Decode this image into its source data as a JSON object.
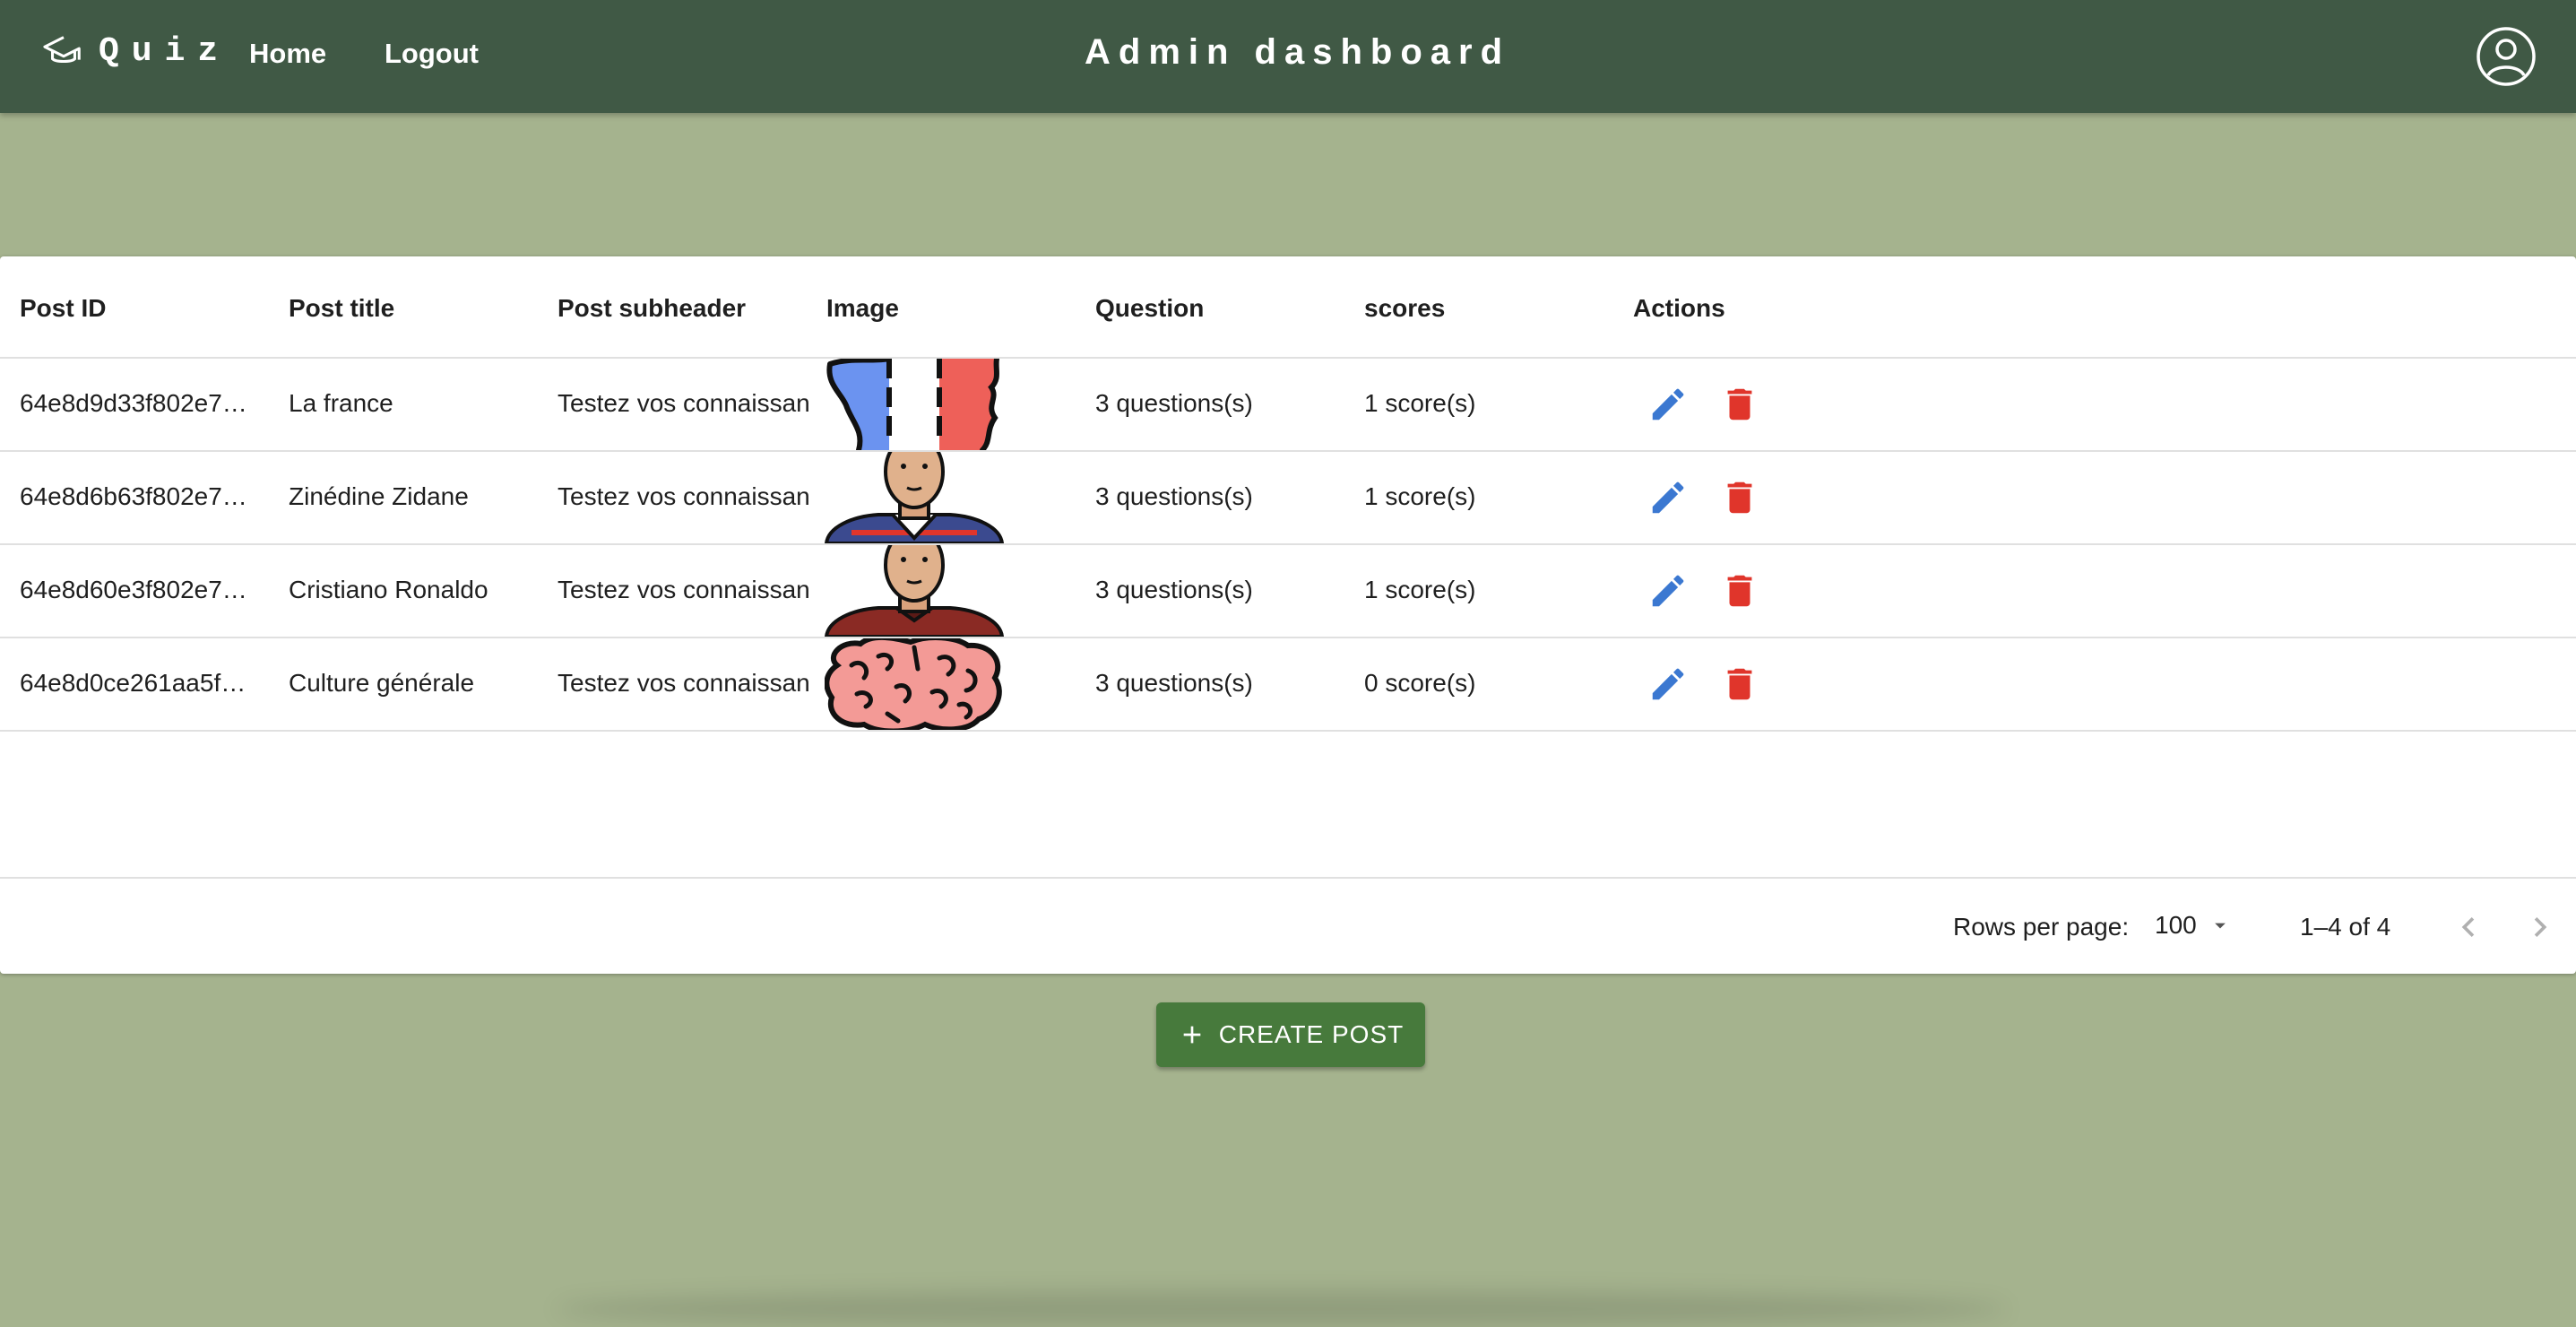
{
  "appbar": {
    "brand": "Quiz",
    "nav": {
      "home": "Home",
      "logout": "Logout"
    },
    "title": "Admin dashboard",
    "account_icon": "account-circle-icon"
  },
  "table": {
    "columns": [
      "Post ID",
      "Post title",
      "Post subheader",
      "Image",
      "Question",
      "scores",
      "Actions"
    ],
    "rows": [
      {
        "id": "64e8d9d33f802e7…",
        "title": "La france",
        "subheader": "Testez vos connaissan",
        "image": "france-map-flag",
        "questions": "3 questions(s)",
        "scores": "1 score(s)"
      },
      {
        "id": "64e8d6b63f802e7…",
        "title": "Zinédine Zidane",
        "subheader": "Testez vos connaissan",
        "image": "player-avatar-blue",
        "questions": "3 questions(s)",
        "scores": "1 score(s)"
      },
      {
        "id": "64e8d60e3f802e7…",
        "title": "Cristiano Ronaldo",
        "subheader": "Testez vos connaissan",
        "image": "player-avatar-red",
        "questions": "3 questions(s)",
        "scores": "1 score(s)"
      },
      {
        "id": "64e8d0ce261aa5f…",
        "title": "Culture générale",
        "subheader": "Testez vos connaissan",
        "image": "brain",
        "questions": "3 questions(s)",
        "scores": "0 score(s)"
      }
    ],
    "actions": {
      "edit_icon": "pencil-icon",
      "delete_icon": "trash-icon"
    }
  },
  "pagination": {
    "rows_per_page_label": "Rows per page:",
    "rows_per_page": "100",
    "range": "1–4 of 4"
  },
  "create_button": {
    "label": "CREATE POST"
  },
  "colors": {
    "appbar": "#405945",
    "background": "#a5b38e",
    "edit": "#3b78d1",
    "delete": "#e0352b",
    "create_button": "#477a3c"
  }
}
